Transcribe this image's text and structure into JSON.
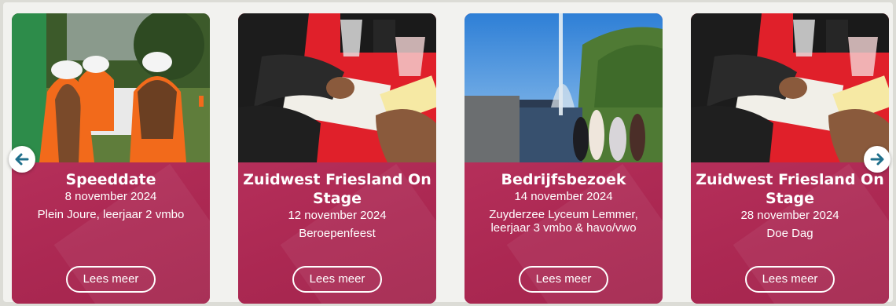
{
  "cards": [
    {
      "title": "Speeddate",
      "date": "8 november 2024",
      "desc": "Plein Joure, leerjaar 2 vmbo",
      "button": "Lees meer",
      "image": "students-hardhats-photo"
    },
    {
      "title": "Zuidwest Friesland On Stage",
      "date": "12 november 2024",
      "desc": "Beroepenfeest",
      "button": "Lees meer",
      "image": "table-writing-photo"
    },
    {
      "title": "Bedrijfsbezoek",
      "date": "14 november 2024",
      "desc": "Zuyderzee Lyceum Lemmer, leerjaar 3 vmbo & havo/vwo",
      "button": "Lees meer",
      "image": "fountain-canal-photo"
    },
    {
      "title": "Zuidwest Friesland On Stage",
      "date": "28 november 2024",
      "desc": "Doe Dag",
      "button": "Lees meer",
      "image": "table-writing-photo"
    }
  ],
  "nav": {
    "prev_icon": "arrow-left-icon",
    "next_icon": "arrow-right-icon"
  },
  "colors": {
    "card": "#b02a55",
    "arrow": "#1f6f8b"
  }
}
